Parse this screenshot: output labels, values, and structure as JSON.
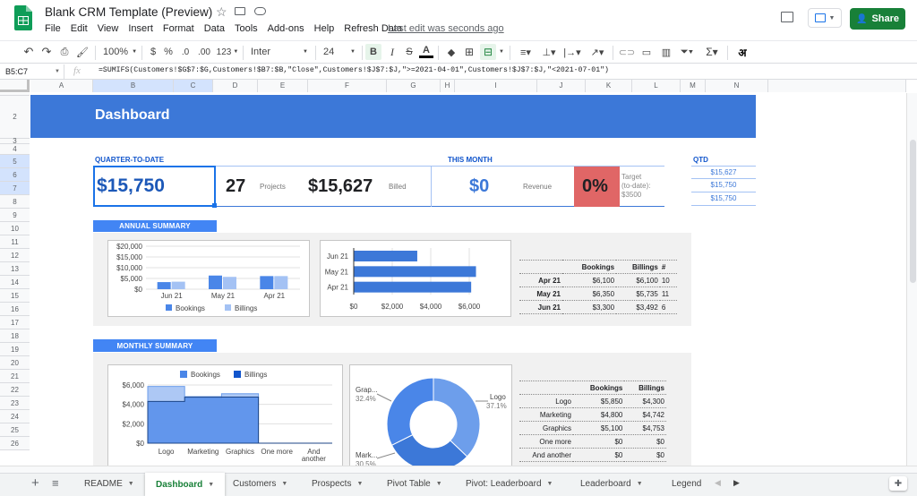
{
  "doc": {
    "title": "Blank CRM Template (Preview)",
    "last_edit": "Last edit was seconds ago",
    "share_label": "Share"
  },
  "menu": [
    "File",
    "Edit",
    "View",
    "Insert",
    "Format",
    "Data",
    "Tools",
    "Add-ons",
    "Help",
    "Refresh Data"
  ],
  "toolbar": {
    "zoom": "100%",
    "currency": "$",
    "percent": "%",
    "dec_less": ".0",
    "dec_more": ".00",
    "more_formats": "123",
    "font": "Inter",
    "font_size": "24",
    "bold": "B",
    "italic": "I",
    "strike": "S",
    "text_color": "A",
    "input_tool": "अ"
  },
  "formula": {
    "cell_ref": "B5:C7",
    "fx": "fx",
    "text": "=SUMIFS(Customers!$G$7:$G,Customers!$B7:$B,\"Close\",Customers!$J$7:$J,\">=2021-04-01\",Customers!$J$7:$J,\"<2021-07-01\")"
  },
  "columns": [
    "A",
    "B",
    "C",
    "D",
    "E",
    "F",
    "G",
    "H",
    "I",
    "J",
    "K",
    "L",
    "M",
    "N"
  ],
  "rows": [
    "1",
    "2",
    "3",
    "4",
    "5",
    "6",
    "7",
    "8",
    "9",
    "10",
    "11",
    "12",
    "13",
    "14",
    "15",
    "16",
    "17",
    "18",
    "19",
    "20",
    "21",
    "22",
    "23",
    "24",
    "25",
    "26"
  ],
  "dashboard": {
    "title": "Dashboard",
    "qtd_label": "QUARTER-TO-DATE",
    "this_month_label": "THIS MONTH",
    "qtd_side_label": "QTD",
    "qtd_value": "$15,750",
    "projects_count": "27",
    "projects_label": "Projects",
    "billed_value": "$15,627",
    "billed_label": "Billed",
    "month_value": "$0",
    "revenue_label": "Revenue",
    "pct_value": "0%",
    "target_lines": [
      "Target",
      "(to-date):",
      "$3500"
    ],
    "qtd_side_values": [
      "$15,627",
      "$15,750",
      "$15,750"
    ],
    "annual_label": "ANNUAL SUMMARY",
    "monthly_label": "MONTHLY SUMMARY"
  },
  "annual_table": {
    "headers": [
      "Bookings",
      "Billings",
      "#"
    ],
    "rows": [
      {
        "month": "Apr 21",
        "bookings": "$6,100",
        "billings": "$6,100",
        "count": "10"
      },
      {
        "month": "May 21",
        "bookings": "$6,350",
        "billings": "$5,735",
        "count": "11"
      },
      {
        "month": "Jun 21",
        "bookings": "$3,300",
        "billings": "$3,492",
        "count": "6"
      }
    ]
  },
  "monthly_table": {
    "headers": [
      "Bookings",
      "Billings"
    ],
    "rows": [
      {
        "cat": "Logo",
        "bookings": "$5,850",
        "billings": "$4,300"
      },
      {
        "cat": "Marketing",
        "bookings": "$4,800",
        "billings": "$4,742"
      },
      {
        "cat": "Graphics",
        "bookings": "$5,100",
        "billings": "$4,753"
      },
      {
        "cat": "One more",
        "bookings": "$0",
        "billings": "$0"
      },
      {
        "cat": "And another",
        "bookings": "$0",
        "billings": "$0"
      }
    ]
  },
  "chart_data": [
    {
      "type": "bar",
      "categories": [
        "Jun 21",
        "May 21",
        "Apr 21"
      ],
      "series": [
        {
          "name": "Bookings",
          "values": [
            3300,
            6350,
            6100
          ]
        },
        {
          "name": "Billings",
          "values": [
            3492,
            5735,
            6100
          ]
        }
      ],
      "ylim": [
        0,
        20000
      ],
      "yticks": [
        "$0",
        "$5,000",
        "$10,000",
        "$15,000",
        "$20,000"
      ],
      "legend": "bottom",
      "colors": [
        "#4a86e8",
        "#a4c2f4"
      ]
    },
    {
      "type": "bar",
      "orientation": "horizontal",
      "categories": [
        "Jun 21",
        "May 21",
        "Apr 21"
      ],
      "values": [
        3300,
        6350,
        6100
      ],
      "xlim": [
        0,
        6000
      ],
      "xticks": [
        "$0",
        "$2,000",
        "$4,000",
        "$6,000"
      ],
      "colors": [
        "#3c78d8"
      ]
    },
    {
      "type": "area",
      "categories": [
        "Logo",
        "Marketing",
        "Graphics",
        "One more",
        "And another"
      ],
      "series": [
        {
          "name": "Bookings",
          "values": [
            5850,
            4800,
            5100,
            0,
            0
          ]
        },
        {
          "name": "Billings",
          "values": [
            4300,
            4742,
            4753,
            0,
            0
          ]
        }
      ],
      "ylim": [
        0,
        6000
      ],
      "yticks": [
        "$0",
        "$2,000",
        "$4,000",
        "$6,000"
      ],
      "legend": "top",
      "colors": [
        "#a4c2f4",
        "#4a86e8"
      ]
    },
    {
      "type": "pie",
      "donut": true,
      "labels": [
        "Logo",
        "Marketing",
        "Graphics"
      ],
      "values": [
        5850,
        4800,
        5100
      ],
      "visible_labels": [
        {
          "name": "Logo",
          "pct": "37.1%"
        },
        {
          "name": "Grap...",
          "pct": "32.4%"
        },
        {
          "name": "Mark...",
          "pct": "30.5%"
        }
      ],
      "colors": [
        "#6d9eeb",
        "#3c78d8",
        "#4a86e8"
      ]
    }
  ],
  "sheet_tabs": [
    "README",
    "Dashboard",
    "Customers",
    "Prospects",
    "Pivot Table",
    "Pivot: Leaderboard",
    "Leaderboard",
    "Legend"
  ],
  "active_tab": "Dashboard",
  "colors": {
    "accent": "#4285f4",
    "share": "#188038",
    "pct_bg": "#e06666",
    "link": "#1a73e8"
  }
}
